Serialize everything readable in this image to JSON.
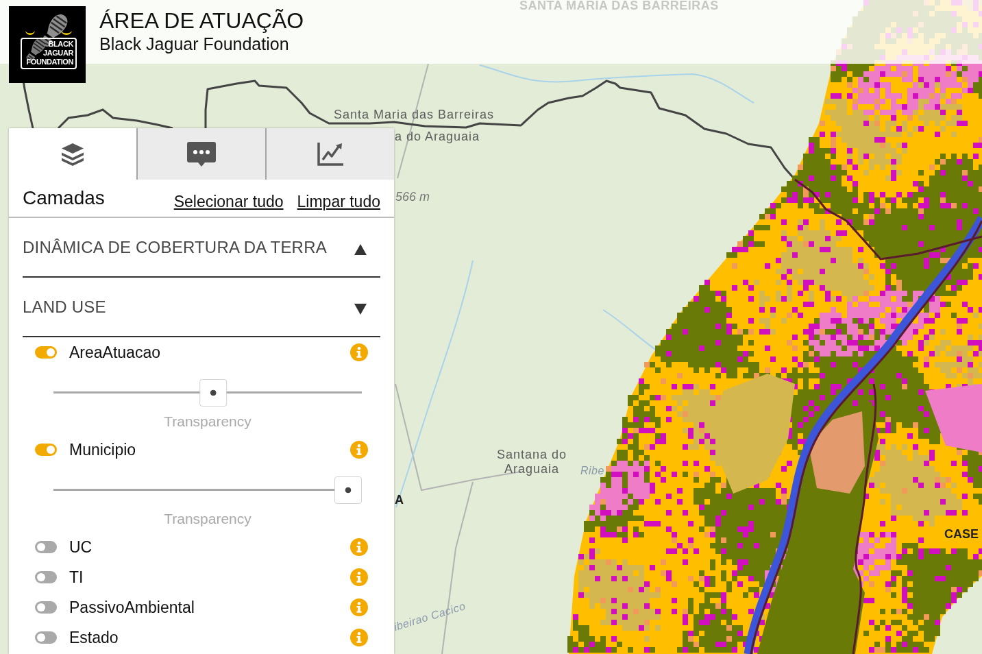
{
  "header": {
    "logo_text": "BLACK JAGUAR FOUNDATION",
    "title": "ÁREA DE ATUAÇÃO",
    "subtitle": "Black Jaguar Foundation"
  },
  "map": {
    "labels": [
      {
        "text": "SANTA MARIA DAS BARREIRAS",
        "kind": "region"
      },
      {
        "text": "Santa Maria das Barreiras",
        "kind": "town"
      },
      {
        "text": "a do Araguaia",
        "kind": "town"
      },
      {
        "text": "566 m",
        "kind": "elevation"
      },
      {
        "text": "Santana do Araguaia",
        "kind": "town"
      },
      {
        "text": "Ribe",
        "kind": "river"
      },
      {
        "text": "A",
        "kind": "area"
      },
      {
        "text": "CASE",
        "kind": "area"
      },
      {
        "text": "ibeirao Cacico",
        "kind": "river"
      }
    ]
  },
  "panel": {
    "tabs": [
      {
        "kind": "layers",
        "selected": true
      },
      {
        "kind": "messages",
        "selected": false
      },
      {
        "kind": "chart",
        "selected": false
      }
    ],
    "heading": "Camadas",
    "actions": [
      "Selecionar tudo",
      "Limpar tudo"
    ],
    "sections": [
      {
        "title": "DINÂMICA DE COBERTURA DA TERRA",
        "expanded": false
      },
      {
        "title": "LAND USE",
        "expanded": true,
        "layers": [
          {
            "label": "AreaAtuacao",
            "on": true,
            "level": 0.52,
            "slider_label": "Transparency"
          },
          {
            "label": "Municipio",
            "on": true,
            "level": 1,
            "slider_label": "Transparency"
          },
          {
            "label": "UC",
            "on": false
          },
          {
            "label": "TI",
            "on": false
          },
          {
            "label": "PassivoAmbiental",
            "on": false
          },
          {
            "label": "Estado",
            "on": false
          }
        ]
      }
    ]
  }
}
